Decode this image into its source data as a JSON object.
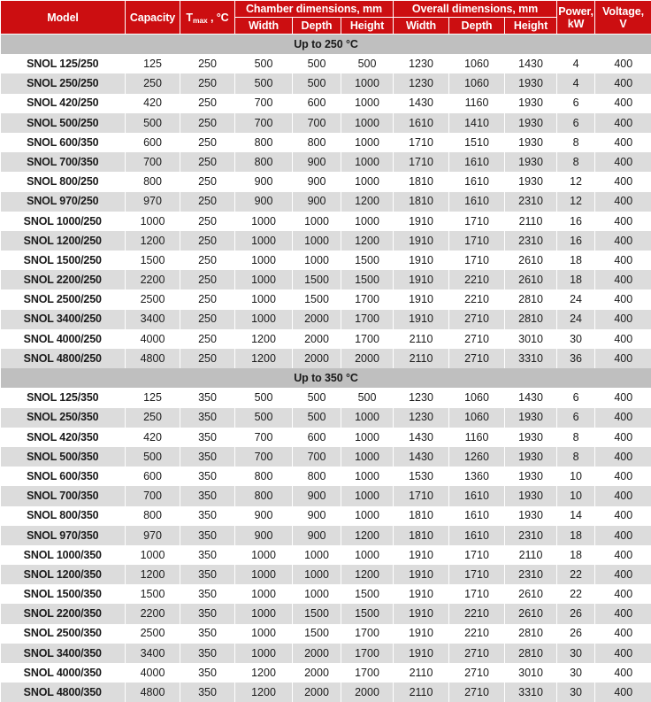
{
  "table": {
    "header": {
      "model": "Model",
      "capacity": "Capacity",
      "tmax_main": "T",
      "tmax_sub": "max",
      "tmax_unit": " , °C",
      "chamber_group": "Chamber dimensions, mm",
      "overall_group": "Overall dimensions, mm",
      "width": "Width",
      "depth": "Depth",
      "height": "Height",
      "power_l1": "Power,",
      "power_l2": "kW",
      "voltage_l1": "Voltage,",
      "voltage_l2": "V"
    },
    "colors": {
      "header_red": "#CC0E11",
      "section_gray": "#BFBFBF",
      "row_alt_gray": "#DCDCDC",
      "row_white": "#FFFFFF",
      "text": "#1A1A1A"
    },
    "sections": [
      {
        "label": "Up to 250 °C",
        "rows": [
          [
            "SNOL 125/250",
            "125",
            "250",
            "500",
            "500",
            "500",
            "1230",
            "1060",
            "1430",
            "4",
            "400"
          ],
          [
            "SNOL 250/250",
            "250",
            "250",
            "500",
            "500",
            "1000",
            "1230",
            "1060",
            "1930",
            "4",
            "400"
          ],
          [
            "SNOL 420/250",
            "420",
            "250",
            "700",
            "600",
            "1000",
            "1430",
            "1160",
            "1930",
            "6",
            "400"
          ],
          [
            "SNOL 500/250",
            "500",
            "250",
            "700",
            "700",
            "1000",
            "1610",
            "1410",
            "1930",
            "6",
            "400"
          ],
          [
            "SNOL 600/350",
            "600",
            "250",
            "800",
            "800",
            "1000",
            "1710",
            "1510",
            "1930",
            "8",
            "400"
          ],
          [
            "SNOL 700/350",
            "700",
            "250",
            "800",
            "900",
            "1000",
            "1710",
            "1610",
            "1930",
            "8",
            "400"
          ],
          [
            "SNOL 800/250",
            "800",
            "250",
            "900",
            "900",
            "1000",
            "1810",
            "1610",
            "1930",
            "12",
            "400"
          ],
          [
            "SNOL 970/250",
            "970",
            "250",
            "900",
            "900",
            "1200",
            "1810",
            "1610",
            "2310",
            "12",
            "400"
          ],
          [
            "SNOL 1000/250",
            "1000",
            "250",
            "1000",
            "1000",
            "1000",
            "1910",
            "1710",
            "2110",
            "16",
            "400"
          ],
          [
            "SNOL 1200/250",
            "1200",
            "250",
            "1000",
            "1000",
            "1200",
            "1910",
            "1710",
            "2310",
            "16",
            "400"
          ],
          [
            "SNOL 1500/250",
            "1500",
            "250",
            "1000",
            "1000",
            "1500",
            "1910",
            "1710",
            "2610",
            "18",
            "400"
          ],
          [
            "SNOL 2200/250",
            "2200",
            "250",
            "1000",
            "1500",
            "1500",
            "1910",
            "2210",
            "2610",
            "18",
            "400"
          ],
          [
            "SNOL 2500/250",
            "2500",
            "250",
            "1000",
            "1500",
            "1700",
            "1910",
            "2210",
            "2810",
            "24",
            "400"
          ],
          [
            "SNOL 3400/250",
            "3400",
            "250",
            "1000",
            "2000",
            "1700",
            "1910",
            "2710",
            "2810",
            "24",
            "400"
          ],
          [
            "SNOL 4000/250",
            "4000",
            "250",
            "1200",
            "2000",
            "1700",
            "2110",
            "2710",
            "3010",
            "30",
            "400"
          ],
          [
            "SNOL 4800/250",
            "4800",
            "250",
            "1200",
            "2000",
            "2000",
            "2110",
            "2710",
            "3310",
            "36",
            "400"
          ]
        ]
      },
      {
        "label": "Up to 350 °C",
        "rows": [
          [
            "SNOL 125/350",
            "125",
            "350",
            "500",
            "500",
            "500",
            "1230",
            "1060",
            "1430",
            "6",
            "400"
          ],
          [
            "SNOL 250/350",
            "250",
            "350",
            "500",
            "500",
            "1000",
            "1230",
            "1060",
            "1930",
            "6",
            "400"
          ],
          [
            "SNOL 420/350",
            "420",
            "350",
            "700",
            "600",
            "1000",
            "1430",
            "1160",
            "1930",
            "8",
            "400"
          ],
          [
            "SNOL 500/350",
            "500",
            "350",
            "700",
            "700",
            "1000",
            "1430",
            "1260",
            "1930",
            "8",
            "400"
          ],
          [
            "SNOL 600/350",
            "600",
            "350",
            "800",
            "800",
            "1000",
            "1530",
            "1360",
            "1930",
            "10",
            "400"
          ],
          [
            "SNOL 700/350",
            "700",
            "350",
            "800",
            "900",
            "1000",
            "1710",
            "1610",
            "1930",
            "10",
            "400"
          ],
          [
            "SNOL 800/350",
            "800",
            "350",
            "900",
            "900",
            "1000",
            "1810",
            "1610",
            "1930",
            "14",
            "400"
          ],
          [
            "SNOL 970/350",
            "970",
            "350",
            "900",
            "900",
            "1200",
            "1810",
            "1610",
            "2310",
            "18",
            "400"
          ],
          [
            "SNOL 1000/350",
            "1000",
            "350",
            "1000",
            "1000",
            "1000",
            "1910",
            "1710",
            "2110",
            "18",
            "400"
          ],
          [
            "SNOL 1200/350",
            "1200",
            "350",
            "1000",
            "1000",
            "1200",
            "1910",
            "1710",
            "2310",
            "22",
            "400"
          ],
          [
            "SNOL 1500/350",
            "1500",
            "350",
            "1000",
            "1000",
            "1500",
            "1910",
            "1710",
            "2610",
            "22",
            "400"
          ],
          [
            "SNOL 2200/350",
            "2200",
            "350",
            "1000",
            "1500",
            "1500",
            "1910",
            "2210",
            "2610",
            "26",
            "400"
          ],
          [
            "SNOL 2500/350",
            "2500",
            "350",
            "1000",
            "1500",
            "1700",
            "1910",
            "2210",
            "2810",
            "26",
            "400"
          ],
          [
            "SNOL 3400/350",
            "3400",
            "350",
            "1000",
            "2000",
            "1700",
            "1910",
            "2710",
            "2810",
            "30",
            "400"
          ],
          [
            "SNOL 4000/350",
            "4000",
            "350",
            "1200",
            "2000",
            "1700",
            "2110",
            "2710",
            "3010",
            "30",
            "400"
          ],
          [
            "SNOL 4800/350",
            "4800",
            "350",
            "1200",
            "2000",
            "2000",
            "2110",
            "2710",
            "3310",
            "30",
            "400"
          ]
        ]
      }
    ]
  }
}
